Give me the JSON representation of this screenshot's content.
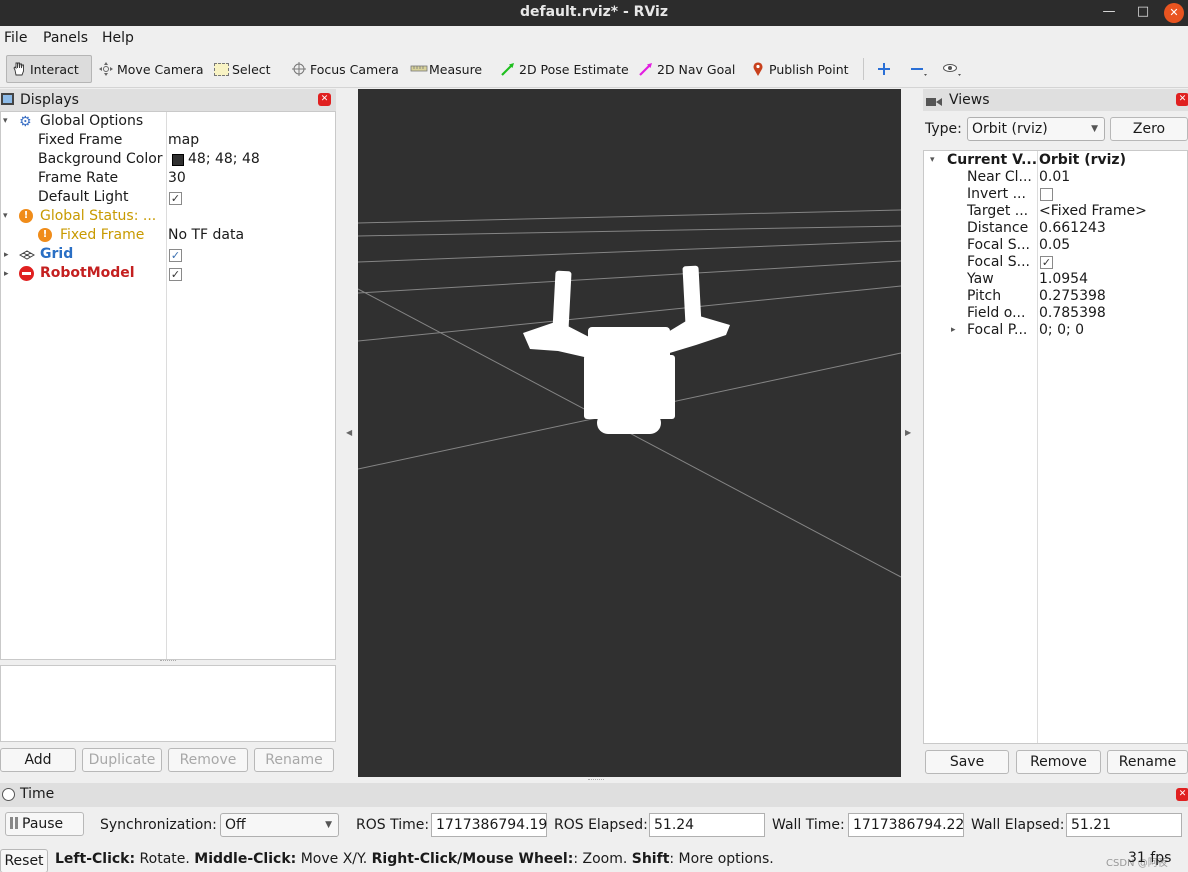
{
  "window": {
    "title": "default.rviz* - RViz"
  },
  "menu": [
    "File",
    "Panels",
    "Help"
  ],
  "toolbar": {
    "tools": [
      {
        "label": "Interact",
        "icon": "hand-icon"
      },
      {
        "label": "Move Camera",
        "icon": "move-camera-icon"
      },
      {
        "label": "Select",
        "icon": "select-icon"
      },
      {
        "label": "Focus Camera",
        "icon": "focus-camera-icon"
      },
      {
        "label": "Measure",
        "icon": "ruler-icon"
      },
      {
        "label": "2D Pose Estimate",
        "icon": "green-arrow-icon"
      },
      {
        "label": "2D Nav Goal",
        "icon": "pink-arrow-icon"
      },
      {
        "label": "Publish Point",
        "icon": "map-pin-icon"
      }
    ],
    "active_tool": "Interact"
  },
  "displays": {
    "title": "Displays",
    "global_options": {
      "label": "Global Options",
      "props": [
        {
          "name": "Fixed Frame",
          "value": "map"
        },
        {
          "name": "Background Color",
          "value": "48; 48; 48",
          "swatch": "#303030"
        },
        {
          "name": "Frame Rate",
          "value": "30"
        },
        {
          "name": "Default Light",
          "value": ""
        }
      ]
    },
    "global_status": {
      "label": "Global Status: ...",
      "child_label": "Fixed Frame",
      "child_value": "No TF data"
    },
    "grid": {
      "label": "Grid"
    },
    "robot_model": {
      "label": "RobotModel"
    },
    "buttons": {
      "add": "Add",
      "duplicate": "Duplicate",
      "remove": "Remove",
      "rename": "Rename"
    }
  },
  "views": {
    "title": "Views",
    "type_label": "Type:",
    "type_value": "Orbit (rviz)",
    "zero": "Zero",
    "current_label": "Current V...",
    "current_value": "Orbit (rviz)",
    "props": [
      {
        "name": "Near Cl...",
        "value": "0.01"
      },
      {
        "name": "Invert ...",
        "value": ""
      },
      {
        "name": "Target ...",
        "value": "<Fixed Frame>"
      },
      {
        "name": "Distance",
        "value": "0.661243"
      },
      {
        "name": "Focal S...",
        "value": "0.05"
      },
      {
        "name": "Focal S...",
        "value": ""
      },
      {
        "name": "Yaw",
        "value": "1.0954"
      },
      {
        "name": "Pitch",
        "value": "0.275398"
      },
      {
        "name": "Field o...",
        "value": "0.785398"
      },
      {
        "name": "Focal P...",
        "value": "0; 0; 0"
      }
    ],
    "buttons": {
      "save": "Save",
      "remove": "Remove",
      "rename": "Rename"
    }
  },
  "time": {
    "title": "Time",
    "pause": "Pause",
    "sync_label": "Synchronization:",
    "sync_value": "Off",
    "ros_time_label": "ROS Time:",
    "ros_time": "1717386794.19",
    "ros_elapsed_label": "ROS Elapsed:",
    "ros_elapsed": "51.24",
    "wall_time_label": "Wall Time:",
    "wall_time": "1717386794.22",
    "wall_elapsed_label": "Wall Elapsed:",
    "wall_elapsed": "51.21"
  },
  "status": {
    "reset": "Reset",
    "help_b1": "Left-Click:",
    "help_t1": " Rotate. ",
    "help_b2": "Middle-Click:",
    "help_t2": " Move X/Y. ",
    "help_b3": "Right-Click/Mouse Wheel:",
    "help_t3": ": Zoom. ",
    "help_b4": "Shift",
    "help_t4": ": More options.",
    "fps": "31 fps",
    "watermark": "CSDN @阿夜"
  }
}
